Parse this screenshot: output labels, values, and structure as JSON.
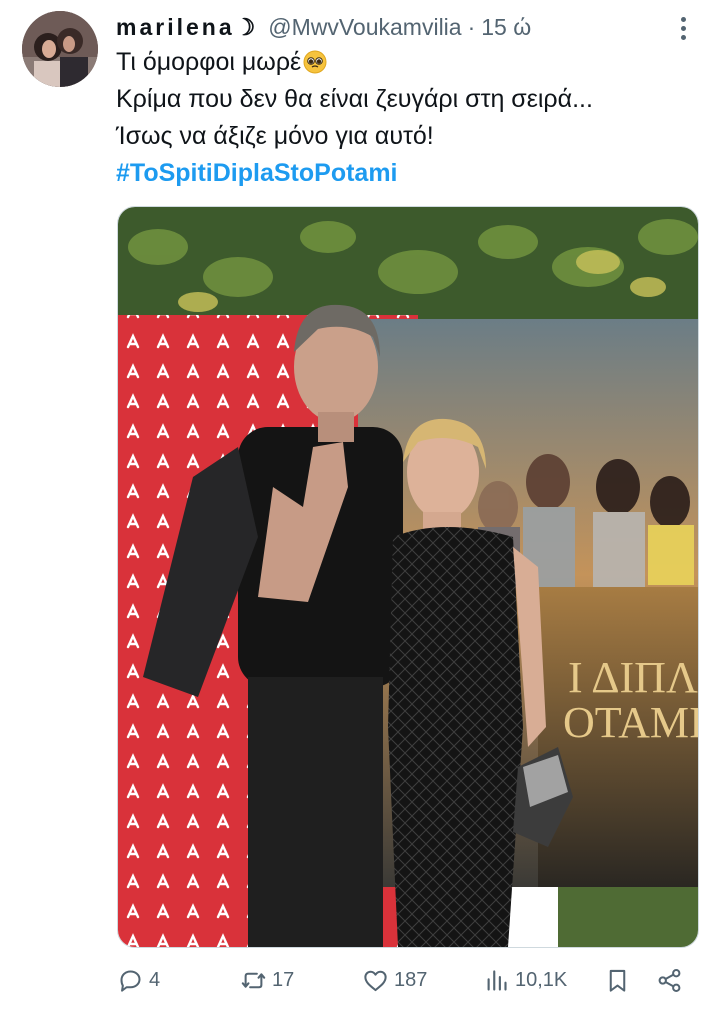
{
  "author": {
    "display_name": "marilena☽",
    "handle": "@MwvVoukamvilia",
    "separator": "·",
    "time": "15 ώ"
  },
  "tweet": {
    "line1": "Τι όμορφοι μωρέ",
    "line2": "Κρίμα που δεν θα είναι ζευγάρι στη σειρά...",
    "line3": "Ίσως να άξιζε μόνο για αυτό!",
    "hashtag": "#ToSpitiDiplaStoPotami"
  },
  "media": {
    "poster_text_line1": "Ι ΔΙΠΛ",
    "poster_text_line2": "ΟΤΑΜΙ"
  },
  "actions": {
    "replies": "4",
    "retweets": "17",
    "likes": "187",
    "views": "10,1K"
  },
  "colors": {
    "hashtag": "#1d9bf0",
    "secondary_text": "#536471",
    "backdrop_red": "#d9323a"
  }
}
